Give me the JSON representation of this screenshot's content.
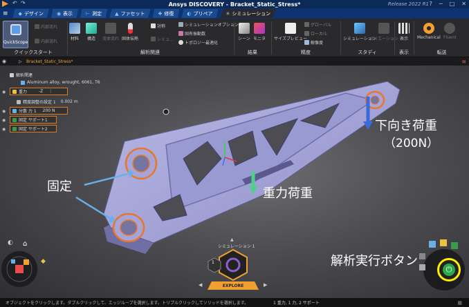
{
  "window": {
    "title": "Ansys DISCOVERY - Bracket_Static_Stress*",
    "release": "Release 2022 R1"
  },
  "tabs": [
    {
      "label": "デザイン"
    },
    {
      "label": "表示"
    },
    {
      "label": "測定"
    },
    {
      "label": "ファセット"
    },
    {
      "label": "修復"
    },
    {
      "label": "プリペア"
    },
    {
      "label": "シミュレーション"
    }
  ],
  "ribbon": {
    "quickstart": {
      "label": "クイックスタート",
      "quickscope": "QuickScope",
      "internal_flow1": "内部流れ",
      "internal_flow2": "内部流れ"
    },
    "analysis": {
      "label": "解析関連",
      "buttons": [
        "材料",
        "構造",
        "流体流れ",
        "固体伝熱",
        "対称",
        "シミュ..."
      ],
      "sim_options": "シミュレーションオプション",
      "result_vars": "固有振動数",
      "topology": "トポロジー最適化"
    },
    "results": {
      "label": "結果",
      "buttons": [
        "シーン",
        "モニタ"
      ]
    },
    "precision": {
      "label": "精度",
      "size_preview": "サイズプレビュー",
      "global": "グローバル",
      "local": "ローカル",
      "resolution": "解像度"
    },
    "study": {
      "label": "スタディ",
      "buttons": [
        "シミュレーション",
        "バリエーション"
      ]
    },
    "display": {
      "label": "表示",
      "buttons": [
        "表示"
      ]
    },
    "transfer": {
      "label": "転送",
      "buttons": [
        "Mechanical",
        "Fluent"
      ]
    }
  },
  "breadcrumb": "Bracket_Static_Stress*",
  "tree": [
    {
      "label": "解析関連"
    },
    {
      "label": "Aluminum alloy, wrought, 6061, T6"
    },
    {
      "label": "重力",
      "value": "-Z"
    },
    {
      "label": "精度調整の設定 1",
      "value": "0.002 m"
    },
    {
      "label": "分散 力 1",
      "value": "200 N"
    },
    {
      "label": "固定 サポート1"
    },
    {
      "label": "固定 サポート2"
    }
  ],
  "annotations": {
    "fixed": "固定",
    "down_load": "下向き荷重",
    "down_load_value": "（200N）",
    "gravity": "重力荷重",
    "run_button": "解析実行ボタン"
  },
  "stage": {
    "label": "シミュレーション 1",
    "step": "1",
    "explore": "EXPLORE"
  },
  "status": {
    "message": "オブジェクトをクリックします。ダブルクリックして、エッジループを選択します。トリプルクリックしてソリッドを選択します。",
    "info": "1 重力, 1 力, 2 サポート"
  },
  "colors": {
    "accent": "#f0a030",
    "title_bg": "#0b2a57",
    "load_arrow": "#3a6bd8",
    "gravity_arrow": "#4fd08a",
    "highlight": "#ffee00"
  }
}
